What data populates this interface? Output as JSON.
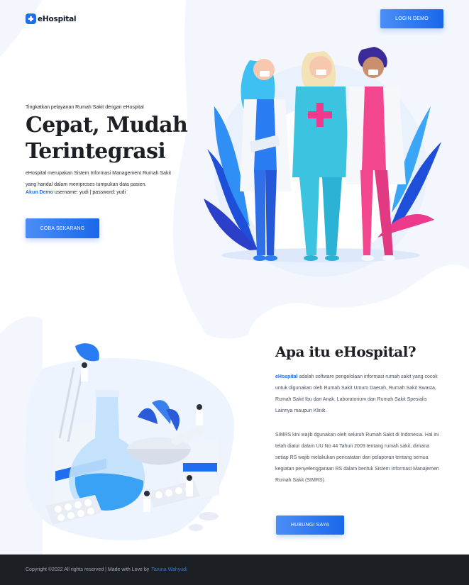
{
  "header": {
    "logo_text": "eHospital",
    "login_label": "LOGIN DEMO"
  },
  "hero": {
    "subtitle": "Tingkatkan pelayanan Rumah Sakit dengan eHospital",
    "title": "Cepat, Mudah Terintegrasi",
    "description": "eHospital merupakan Sistem Informasi Management Rumah Sakit yang handal dalam memproses tumpukan data pasien.",
    "demo_label": "Akun Demo",
    "demo_credentials": " username: yudi | password: yudi",
    "cta_label": "COBA SEKARANG"
  },
  "about": {
    "title": "Apa itu eHospital?",
    "brand": "eHospital",
    "paragraph1": " adalah software pengelolaan informasi rumah sakit yang cocok untuk digunakan oleh Rumah Sakit Umum Daerah, Rumah Sakit Swasta, Rumah Sakit Ibu dan Anak, Laboratorium dan Rumah Sakit Spesialis Lainnya maupun Klinik.",
    "paragraph2": "SIMRS kini wajib dgunakan oleh seluruh Rumah Sakit di Indonesia. Hal ini telah diatur dalam UU No 44 Tahun 2009 tentang rumah sakit, dimana setiap RS wajib melakukan pencatatan dan pelaporan tentang semua kegiatan penyelenggaraan RS dalam bentuk Sistem Informasi Manajemen Rumah Sakit (SIMRS).",
    "contact_label": "HUBUNGI SAYA"
  },
  "footer": {
    "copyright": "Copyright ©2022 All rights reserved | Made with Love by",
    "author": "Taruna Wahyudi"
  },
  "colors": {
    "primary": "#1e6ff0",
    "footer_bg": "#1b1e22"
  },
  "icons": {
    "logo": "hospital-cross-icon"
  }
}
